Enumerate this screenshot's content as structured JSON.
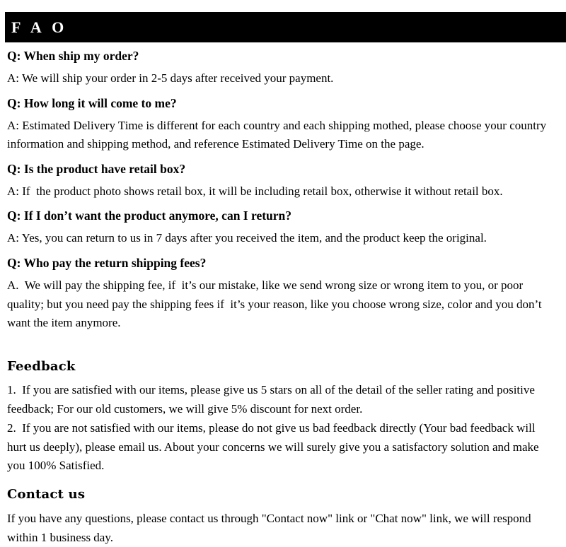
{
  "banner": {
    "title": "F A O",
    "background_color": "#000000",
    "text_color": "#ffffff"
  },
  "faq": {
    "items": [
      {
        "question": "Q: When ship my order?",
        "answer": "A: We will ship your order in 2-5 days after received your payment."
      },
      {
        "question": "Q: How long it will come to me?",
        "answer": "A: Estimated Delivery Time is different for each country and each shipping mothed, please choose your country information and shipping method, and reference Estimated Delivery Time on the page."
      },
      {
        "question": "Q: Is the product have retail box?",
        "answer": "A: If  the product photo shows retail box, it will be including retail box, otherwise it without retail box."
      },
      {
        "question": "Q: If I don’t want the product anymore, can I return?",
        "answer": "A: Yes, you can return to us in 7 days after you received the item, and the product keep the original."
      },
      {
        "question": "Q: Who pay the return shipping fees?",
        "answer": "A.  We will pay the shipping fee, if  it’s our mistake, like we send wrong size or wrong item to you, or poor quality; but you need pay the shipping fees if  it’s your reason, like you choose wrong size, color and you don’t want the item anymore."
      }
    ]
  },
  "feedback": {
    "heading": "Feedback",
    "paragraphs": [
      "1.  If you are satisfied with our items, please give us 5 stars on all of the detail of the seller rating and positive feedback; For our old customers, we will give 5% discount for next order.",
      "2.  If you are not satisfied with our items, please do not give us bad feedback directly (Your bad feedback will hurt us deeply), please email us. About your concerns we will surely give you a satisfactory solution and make you 100% Satisfied."
    ]
  },
  "contact": {
    "heading": "Contact us",
    "paragraph": "If you have any questions, please contact us through \"Contact now\" link or \"Chat now\" link, we will respond within 1 business day."
  }
}
